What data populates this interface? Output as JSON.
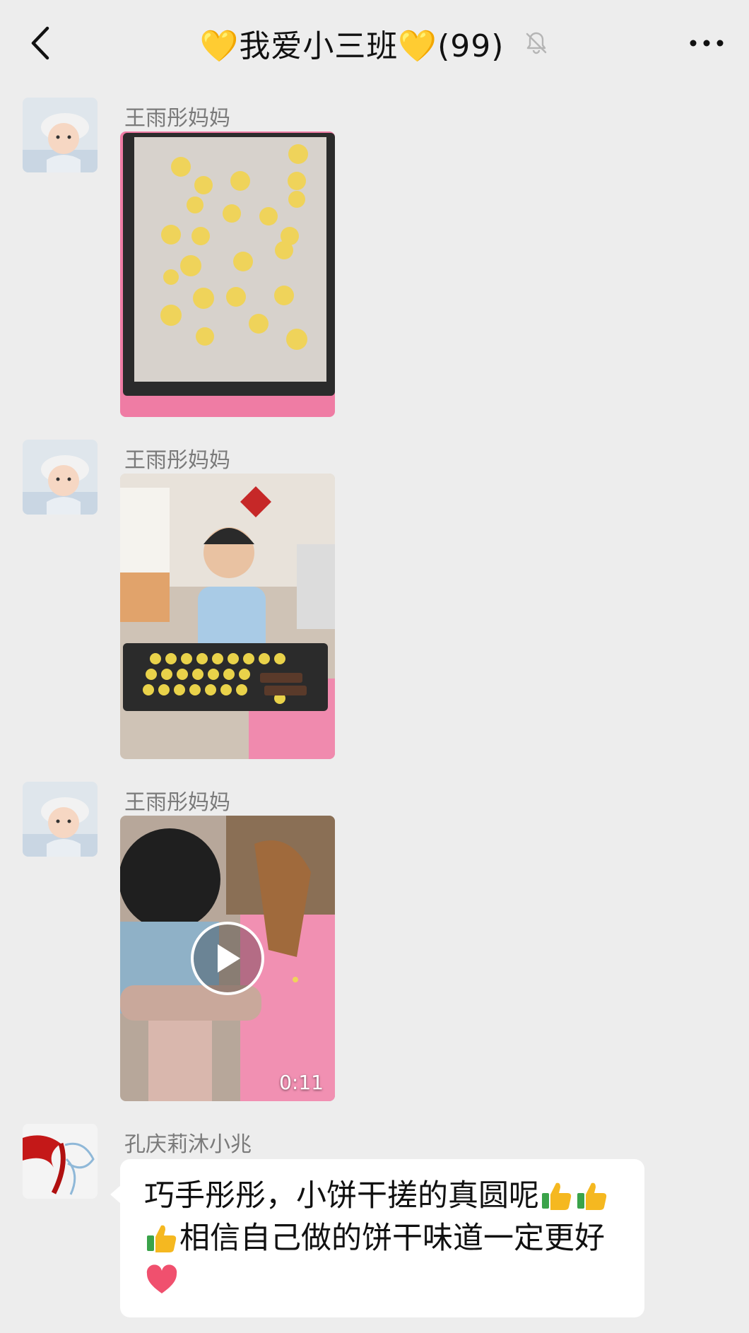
{
  "header": {
    "title": "💛我爱小三班💛(99)",
    "back_icon": "chevron-left-icon",
    "mute_icon": "bell-off-icon",
    "more_icon": "more-dots-icon"
  },
  "messages": [
    {
      "sender": "王雨彤妈妈",
      "type": "image",
      "image": "cookie-dough-balls-on-tray"
    },
    {
      "sender": "王雨彤妈妈",
      "type": "image",
      "image": "boy-holding-cookie-tray"
    },
    {
      "sender": "王雨彤妈妈",
      "type": "video",
      "duration": "0:11",
      "image": "child-making-cookies-video"
    },
    {
      "sender": "孔庆莉沐小兆",
      "type": "text",
      "text_parts": [
        "巧手彤彤，小饼干搓的真圆呢",
        "相信自己做的饼干味道一定更好"
      ],
      "emojis": [
        "thumbs-up-icon",
        "thumbs-up-icon",
        "thumbs-up-icon",
        "heart-icon"
      ]
    }
  ],
  "colors": {
    "background": "#ededed",
    "bubble": "#ffffff",
    "sender_text": "#7a7a7a",
    "heart": "#f0506e",
    "thumb": "#f5b820"
  }
}
